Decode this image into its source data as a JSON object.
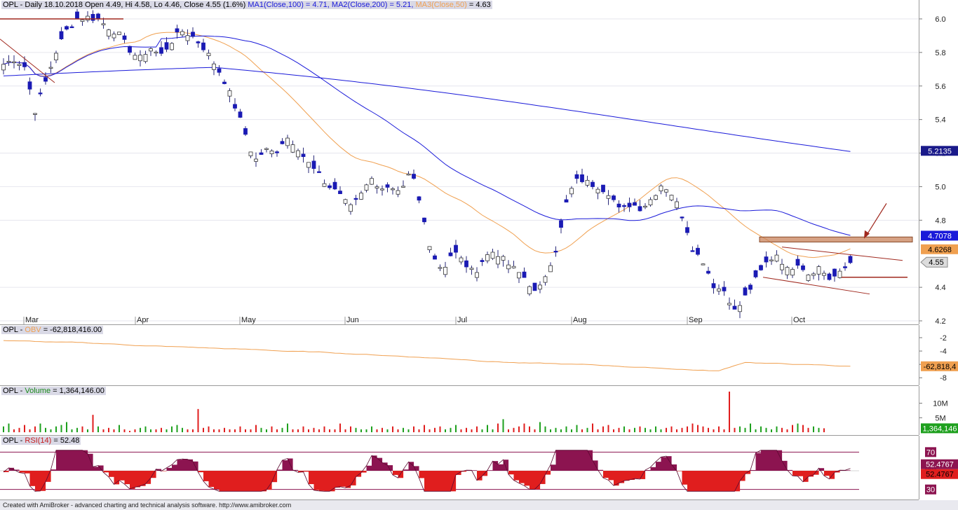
{
  "header": {
    "symbol": "OPL",
    "text": "OPL - Daily 18.10.2018 Open 4.49, Hi 4.58, Lo 4.46, Close 4.55 (1.6%)",
    "ma1": "MA1(Close,100) = 4.71,",
    "ma2": "MA2(Close,200) = 5.21,",
    "ma3_label": "MA3(Close,50)",
    "ma3_value": "= 4.63"
  },
  "obv_header": {
    "prefix": "OPL - ",
    "name": "OBV",
    "value": "= -62,818,416.00"
  },
  "volume_header": {
    "prefix": "OPL - ",
    "name": "Volume",
    "value": "= 1,364,146.00"
  },
  "rsi_header": {
    "prefix": "OPL - ",
    "name": "RSI(14)",
    "value": "= 52.48"
  },
  "footer": "Created with AmiBroker - advanced charting and technical analysis software. http://www.amibroker.com",
  "colors": {
    "up": "#ffffff",
    "down": "#1a1ab4",
    "ma100": "#1a1ad9",
    "ma200": "#1a1ad9",
    "ma50": "#f0a050",
    "trend": "#a0281e",
    "zone": "#c8825a",
    "vol_up": "#1ea01e",
    "vol_down": "#e01e1e",
    "rsi_above": "#8c1450",
    "rsi_below": "#e01e1e"
  },
  "badges": {
    "ma200": "5.2135",
    "ma100": "4.7078",
    "ma50": "4.6268",
    "close": "4.55",
    "obv": "-62,818,4",
    "volume": "1,364,146",
    "rsi_a": "52.4767",
    "rsi_b": "52.4767"
  },
  "chart_data": [
    {
      "type": "candlestick",
      "name": "OPL price",
      "x_ticks": [
        "Mar",
        "Apr",
        "May",
        "Jun",
        "Jul",
        "Aug",
        "Sep",
        "Oct"
      ],
      "y_ticks": [
        "6.0",
        "5.8",
        "5.6",
        "5.4",
        "5.2",
        "5.0",
        "4.8",
        "4.4",
        "4.2"
      ],
      "ylim": [
        4.2,
        6.05
      ],
      "series": [
        {
          "name": "MA1(Close,100)",
          "last": 4.71
        },
        {
          "name": "MA2(Close,200)",
          "last": 5.21
        },
        {
          "name": "MA3(Close,50)",
          "last": 4.63
        }
      ],
      "close_path": [
        5.73,
        5.76,
        5.72,
        5.45,
        5.62,
        5.8,
        5.93,
        6.0,
        6.01,
        6.0,
        5.95,
        5.91,
        5.82,
        5.76,
        5.83,
        5.78,
        5.86,
        5.93,
        5.9,
        5.84,
        5.75,
        5.65,
        5.5,
        5.34,
        5.15,
        5.22,
        5.2,
        5.3,
        5.25,
        5.15,
        5.08,
        5.0,
        4.98,
        4.88,
        4.95,
        5.05,
        5.0,
        4.98,
        4.95,
        5.1,
        4.85,
        4.6,
        4.5,
        4.62,
        4.55,
        4.48,
        4.58,
        4.62,
        4.55,
        4.5,
        4.45,
        4.35,
        4.5,
        4.65,
        4.95,
        5.05,
        5.02,
        5.0,
        4.96,
        4.85,
        4.9,
        4.87,
        4.93,
        5.02,
        4.95,
        4.82,
        4.62,
        4.55,
        4.4,
        4.38,
        4.25,
        4.35,
        4.45,
        4.55,
        4.6,
        4.5,
        4.55,
        4.48,
        4.52,
        4.45,
        4.48,
        4.55
      ]
    },
    {
      "type": "line",
      "name": "OBV",
      "y_ticks": [
        "-2",
        "-4",
        "-6",
        "-8"
      ],
      "last": "-62,818,416.00"
    },
    {
      "type": "bar",
      "name": "Volume",
      "y_ticks": [
        "10M",
        "5M"
      ],
      "last": "1,364,146.00",
      "values_millions": [
        2,
        3,
        1,
        1.5,
        2.5,
        1,
        2,
        3,
        1.5,
        1,
        2,
        2.5,
        3.5,
        1,
        1.5,
        2,
        1,
        6,
        2,
        1,
        1.5,
        1,
        2.5,
        1,
        0.5,
        1,
        1.5,
        2,
        1,
        1,
        1.5,
        1,
        2,
        2.5,
        1.5,
        1,
        1,
        8,
        1.5,
        2,
        1,
        1,
        1.5,
        1,
        1,
        2,
        1,
        1,
        2.5,
        1.5,
        1,
        2,
        1,
        1.5,
        3,
        1,
        1,
        2,
        1,
        1.5,
        1,
        2,
        1,
        1,
        3,
        1,
        2,
        1.5,
        1,
        1,
        2,
        1,
        1.5,
        1,
        2,
        1,
        1.5,
        1,
        2,
        1,
        2.5,
        1,
        1.5,
        2,
        1,
        1.5,
        2.5,
        1,
        1.5,
        1,
        2,
        1,
        2.5,
        1,
        3,
        4.5,
        1,
        1.5,
        2,
        3,
        2,
        1,
        3.5,
        2,
        1,
        1.5,
        1,
        2,
        1,
        2.5,
        1,
        1.5,
        3,
        1,
        2,
        2.5,
        1,
        1.5,
        2,
        1,
        1.5,
        2,
        1.5,
        1,
        2,
        1,
        1.5,
        2,
        1,
        1.5,
        2,
        3,
        2.5,
        2,
        1.5,
        1,
        2,
        1,
        14,
        1.5,
        2,
        1.5,
        3,
        1,
        2,
        1.5,
        1,
        2,
        1.5,
        1,
        2.5,
        3,
        2.5,
        1.5,
        2,
        1.5,
        1.36
      ]
    },
    {
      "type": "area",
      "name": "RSI(14)",
      "y_ticks": [
        "70",
        "50",
        "30"
      ],
      "last": 52.48
    }
  ]
}
